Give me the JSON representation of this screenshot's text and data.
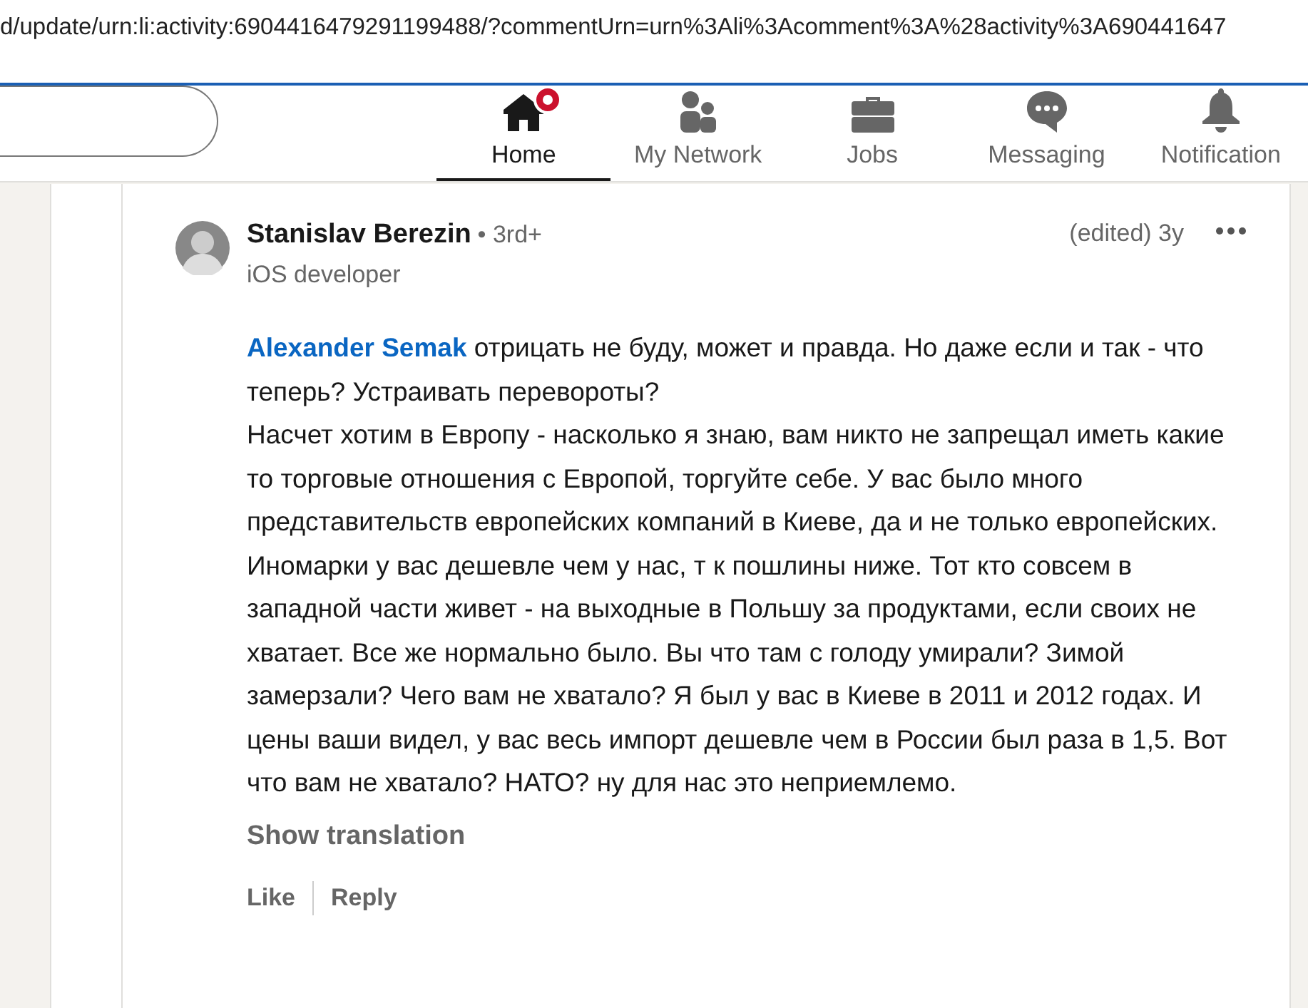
{
  "address_bar": {
    "url": "d/update/urn:li:activity:6904416479291199488/?commentUrn=urn%3Ali%3Acomment%3A%28activity%3A690441647"
  },
  "nav": {
    "items": [
      {
        "label": "Home",
        "kind": "home",
        "selected": true,
        "badge": true
      },
      {
        "label": "My Network",
        "kind": "network",
        "selected": false,
        "badge": false
      },
      {
        "label": "Jobs",
        "kind": "jobs",
        "selected": false,
        "badge": false
      },
      {
        "label": "Messaging",
        "kind": "messaging",
        "selected": false,
        "badge": false
      },
      {
        "label": "Notification",
        "kind": "notifications",
        "selected": false,
        "badge": false
      }
    ]
  },
  "comment": {
    "author": "Stanislav Berezin",
    "degree": "• 3rd+",
    "headline": "iOS developer",
    "time": "(edited) 3y",
    "mention": "Alexander Semak",
    "text": " отрицать не буду, может и правда. Но даже если и так - что теперь? Устраивать перевороты?\nНасчет хотим в Европу - насколько я знаю, вам никто не запрещал иметь какие то торговые отношения с Европой, торгуйте себе. У вас было много представительств европейских компаний в Киеве, да и не только европейских. Иномарки у вас дешевле чем у нас, т к пошлины ниже. Тот кто совсем в западной части живет - на выходные в Польшу за продуктами, если своих не хватает. Все же нормально было. Вы что там с голоду умирали? Зимой замерзали? Чего вам не хватало? Я был у вас в Киеве в 2011 и 2012 годах. И цены ваши видел, у вас весь импорт дешевле чем в России был раза в 1,5. Вот что вам не хватало? НАТО? ну для нас это неприемлемо.",
    "translate": "Show translation",
    "actions": [
      "Like",
      "Reply"
    ]
  }
}
